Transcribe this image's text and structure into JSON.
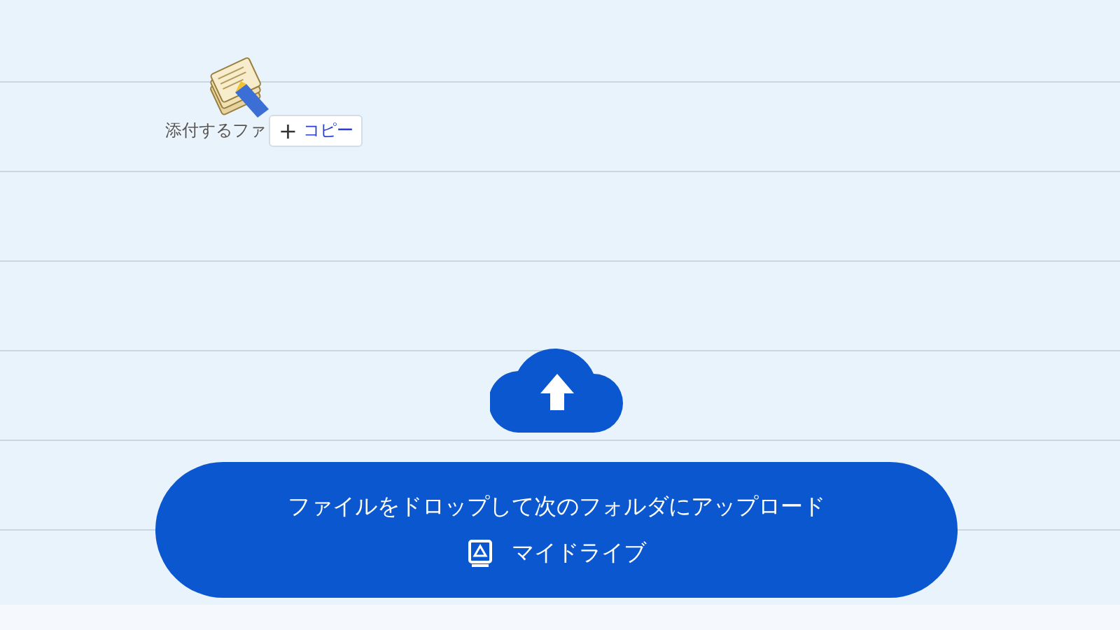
{
  "drag_item": {
    "label": "添付するファ",
    "badge_symbol": "+",
    "badge_text": "コピー"
  },
  "drop_zone": {
    "message": "ファイルをドロップして次のフォルダにアップロード",
    "folder": "マイドライブ"
  }
}
